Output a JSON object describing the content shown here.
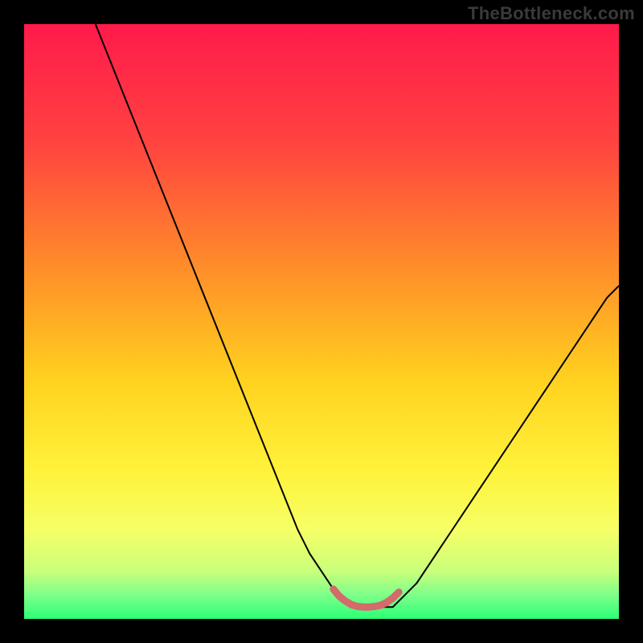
{
  "watermark": "TheBottleneck.com",
  "chart_data": {
    "type": "line",
    "title": "",
    "xlabel": "",
    "ylabel": "",
    "xlim": [
      0,
      100
    ],
    "ylim": [
      0,
      100
    ],
    "grid": false,
    "series": [
      {
        "name": "curve",
        "x": [
          12,
          14,
          16,
          18,
          20,
          22,
          24,
          26,
          28,
          30,
          32,
          34,
          36,
          38,
          40,
          42,
          44,
          46,
          48,
          50,
          52,
          54,
          55,
          56,
          57,
          58,
          59,
          60,
          61,
          62,
          63,
          64,
          66,
          68,
          70,
          72,
          74,
          76,
          78,
          80,
          82,
          84,
          86,
          88,
          90,
          92,
          94,
          96,
          98,
          100
        ],
        "y": [
          100,
          95,
          90,
          85,
          80,
          75,
          70,
          65,
          60,
          55,
          50,
          45,
          40,
          35,
          30,
          25,
          20,
          15,
          11,
          8,
          5,
          3,
          2,
          2,
          2,
          2,
          2,
          2,
          2,
          2,
          3,
          4,
          6,
          9,
          12,
          15,
          18,
          21,
          24,
          27,
          30,
          33,
          36,
          39,
          42,
          45,
          48,
          51,
          54,
          56
        ]
      },
      {
        "name": "bottom-segment",
        "x": [
          52,
          53,
          54,
          55,
          56,
          57,
          58,
          59,
          60,
          61,
          62,
          63
        ],
        "y": [
          5,
          3.8,
          3,
          2.4,
          2.1,
          2,
          2,
          2.1,
          2.3,
          2.8,
          3.5,
          4.5
        ]
      }
    ],
    "gradient_stops": [
      {
        "offset": 0,
        "color": "#ff1a4b"
      },
      {
        "offset": 20,
        "color": "#ff4340"
      },
      {
        "offset": 40,
        "color": "#ff8a2a"
      },
      {
        "offset": 60,
        "color": "#ffd21f"
      },
      {
        "offset": 75,
        "color": "#fff23a"
      },
      {
        "offset": 85,
        "color": "#f6ff66"
      },
      {
        "offset": 92,
        "color": "#c9ff7a"
      },
      {
        "offset": 96,
        "color": "#7dff8a"
      },
      {
        "offset": 100,
        "color": "#2bff77"
      }
    ],
    "colors": {
      "curve_stroke": "#000000",
      "bottom_segment_stroke": "#d46a6a"
    }
  }
}
